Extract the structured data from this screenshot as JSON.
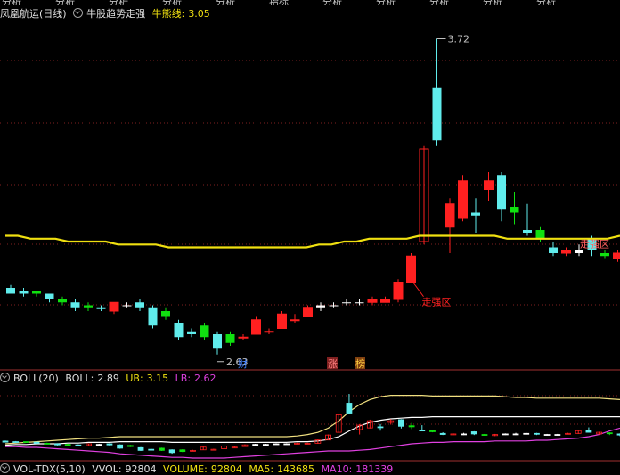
{
  "top_menu": [
    "分析",
    "分析",
    "分析",
    "分析",
    "分析",
    "指标",
    "分析",
    "分析",
    "分析",
    "分析",
    "分析"
  ],
  "header": {
    "stock_name": "凤凰航运(日线)",
    "indicator_name": "牛股趋势走强",
    "bull_line_label": "牛熊线:",
    "bull_line_value": "3.05"
  },
  "annotations": {
    "high_label": "3.72",
    "low_label": "2.63",
    "strong_zone": "走强区",
    "right_marker": "走强区",
    "event_cai": "财",
    "event_zhang": "涨",
    "event_bang": "榜"
  },
  "boll": {
    "name": "BOLL(20)",
    "boll_label": "BOLL:",
    "boll_value": "2.89",
    "ub_label": "UB:",
    "ub_value": "3.15",
    "lb_label": "LB:",
    "lb_value": "2.62"
  },
  "volume": {
    "name": "VOL-TDX(5,10)",
    "vvol_label": "VVOL:",
    "vvol_value": "92804",
    "volume_label": "VOLUME:",
    "volume_value": "92804",
    "ma5_label": "MA5:",
    "ma5_value": "143685",
    "ma10_label": "MA10:",
    "ma10_value": "181339"
  },
  "colors": {
    "up": "#ff2020",
    "down_cyan": "#60ecec",
    "green": "#10e010",
    "bull_line": "#f0e010",
    "boll_mid": "#ffffff",
    "boll_ub": "#f0e080",
    "boll_lb": "#e040e0",
    "grid": "#802020"
  },
  "chart_data": {
    "type": "candlestick",
    "y_range": [
      2.58,
      3.78
    ],
    "bull_line": [
      3.04,
      3.04,
      3.03,
      3.03,
      3.03,
      3.02,
      3.02,
      3.02,
      3.02,
      3.01,
      3.01,
      3.01,
      3.01,
      3.0,
      3.0,
      3.0,
      3.0,
      3.0,
      3.0,
      3.0,
      3.0,
      3.0,
      3.0,
      3.0,
      3.0,
      3.01,
      3.01,
      3.02,
      3.02,
      3.03,
      3.03,
      3.03,
      3.03,
      3.04,
      3.04,
      3.04,
      3.04,
      3.04,
      3.04,
      3.04,
      3.03,
      3.03,
      3.03,
      3.03,
      3.03,
      3.03,
      3.03,
      3.03,
      3.03,
      3.04
    ],
    "candles": [
      {
        "o": 2.86,
        "h": 2.87,
        "l": 2.84,
        "c": 2.84,
        "t": "c"
      },
      {
        "o": 2.85,
        "h": 2.86,
        "l": 2.83,
        "c": 2.84,
        "t": "c"
      },
      {
        "o": 2.85,
        "h": 2.85,
        "l": 2.83,
        "c": 2.84,
        "t": "g"
      },
      {
        "o": 2.84,
        "h": 2.84,
        "l": 2.81,
        "c": 2.82,
        "t": "c"
      },
      {
        "o": 2.82,
        "h": 2.83,
        "l": 2.8,
        "c": 2.81,
        "t": "g"
      },
      {
        "o": 2.81,
        "h": 2.82,
        "l": 2.78,
        "c": 2.79,
        "t": "c"
      },
      {
        "o": 2.8,
        "h": 2.81,
        "l": 2.78,
        "c": 2.79,
        "t": "g"
      },
      {
        "o": 2.79,
        "h": 2.8,
        "l": 2.78,
        "c": 2.79,
        "t": "c"
      },
      {
        "o": 2.78,
        "h": 2.81,
        "l": 2.77,
        "c": 2.81,
        "t": "r"
      },
      {
        "o": 2.8,
        "h": 2.81,
        "l": 2.79,
        "c": 2.8,
        "t": "w"
      },
      {
        "o": 2.81,
        "h": 2.82,
        "l": 2.78,
        "c": 2.79,
        "t": "c"
      },
      {
        "o": 2.79,
        "h": 2.8,
        "l": 2.72,
        "c": 2.73,
        "t": "c"
      },
      {
        "o": 2.78,
        "h": 2.79,
        "l": 2.75,
        "c": 2.76,
        "t": "g"
      },
      {
        "o": 2.74,
        "h": 2.75,
        "l": 2.68,
        "c": 2.69,
        "t": "c"
      },
      {
        "o": 2.7,
        "h": 2.72,
        "l": 2.69,
        "c": 2.71,
        "t": "c"
      },
      {
        "o": 2.73,
        "h": 2.74,
        "l": 2.68,
        "c": 2.69,
        "t": "g"
      },
      {
        "o": 2.7,
        "h": 2.71,
        "l": 2.63,
        "c": 2.65,
        "t": "c"
      },
      {
        "o": 2.67,
        "h": 2.71,
        "l": 2.66,
        "c": 2.7,
        "t": "g"
      },
      {
        "o": 2.69,
        "h": 2.7,
        "l": 2.68,
        "c": 2.69,
        "t": "r"
      },
      {
        "o": 2.7,
        "h": 2.76,
        "l": 2.7,
        "c": 2.75,
        "t": "r"
      },
      {
        "o": 2.71,
        "h": 2.72,
        "l": 2.7,
        "c": 2.71,
        "t": "r"
      },
      {
        "o": 2.72,
        "h": 2.78,
        "l": 2.72,
        "c": 2.77,
        "t": "r"
      },
      {
        "o": 2.75,
        "h": 2.77,
        "l": 2.74,
        "c": 2.75,
        "t": "r"
      },
      {
        "o": 2.76,
        "h": 2.8,
        "l": 2.76,
        "c": 2.79,
        "t": "r"
      },
      {
        "o": 2.8,
        "h": 2.81,
        "l": 2.78,
        "c": 2.79,
        "t": "w"
      },
      {
        "o": 2.8,
        "h": 2.81,
        "l": 2.79,
        "c": 2.8,
        "t": "w"
      },
      {
        "o": 2.81,
        "h": 2.82,
        "l": 2.8,
        "c": 2.81,
        "t": "w"
      },
      {
        "o": 2.81,
        "h": 2.82,
        "l": 2.8,
        "c": 2.81,
        "t": "w"
      },
      {
        "o": 2.82,
        "h": 2.83,
        "l": 2.8,
        "c": 2.81,
        "t": "r"
      },
      {
        "o": 2.81,
        "h": 2.83,
        "l": 2.81,
        "c": 2.82,
        "t": "r"
      },
      {
        "o": 2.82,
        "h": 2.89,
        "l": 2.81,
        "c": 2.88,
        "t": "r"
      },
      {
        "o": 2.88,
        "h": 2.98,
        "l": 2.88,
        "c": 2.97,
        "t": "r"
      },
      {
        "o": 3.02,
        "h": 3.35,
        "l": 3.01,
        "c": 3.34,
        "t": "ro"
      },
      {
        "o": 3.55,
        "h": 3.72,
        "l": 3.35,
        "c": 3.37,
        "t": "c"
      },
      {
        "o": 3.15,
        "h": 3.17,
        "l": 2.98,
        "c": 3.07,
        "t": "r"
      },
      {
        "o": 3.1,
        "h": 3.25,
        "l": 3.09,
        "c": 3.23,
        "t": "r"
      },
      {
        "o": 3.12,
        "h": 3.17,
        "l": 3.05,
        "c": 3.11,
        "t": "c"
      },
      {
        "o": 3.23,
        "h": 3.26,
        "l": 3.16,
        "c": 3.2,
        "t": "r"
      },
      {
        "o": 3.25,
        "h": 3.26,
        "l": 3.09,
        "c": 3.13,
        "t": "c"
      },
      {
        "o": 3.14,
        "h": 3.19,
        "l": 3.08,
        "c": 3.12,
        "t": "g"
      },
      {
        "o": 3.05,
        "h": 3.15,
        "l": 3.04,
        "c": 3.06,
        "t": "c"
      },
      {
        "o": 3.06,
        "h": 3.07,
        "l": 3.02,
        "c": 3.03,
        "t": "g"
      },
      {
        "o": 3.0,
        "h": 3.02,
        "l": 2.97,
        "c": 2.98,
        "t": "c"
      },
      {
        "o": 2.98,
        "h": 3.0,
        "l": 2.97,
        "c": 2.99,
        "t": "r"
      },
      {
        "o": 2.99,
        "h": 3.01,
        "l": 2.97,
        "c": 2.98,
        "t": "w"
      },
      {
        "o": 3.03,
        "h": 3.04,
        "l": 2.97,
        "c": 2.99,
        "t": "c"
      },
      {
        "o": 2.98,
        "h": 2.99,
        "l": 2.96,
        "c": 2.97,
        "t": "g"
      },
      {
        "o": 2.96,
        "h": 2.99,
        "l": 2.95,
        "c": 2.98,
        "t": "r"
      },
      {
        "o": 2.98,
        "h": 3.0,
        "l": 2.97,
        "c": 2.99,
        "t": "w"
      },
      {
        "o": 2.99,
        "h": 3.01,
        "l": 2.97,
        "c": 2.99,
        "t": "w"
      },
      {
        "o": 3.0,
        "h": 3.01,
        "l": 2.98,
        "c": 2.99,
        "t": "w"
      },
      {
        "o": 3.0,
        "h": 3.01,
        "l": 2.97,
        "c": 2.99,
        "t": "c"
      },
      {
        "o": 2.98,
        "h": 2.99,
        "l": 2.96,
        "c": 2.98,
        "t": "w"
      },
      {
        "o": 2.98,
        "h": 2.99,
        "l": 2.96,
        "c": 2.98,
        "t": "w"
      },
      {
        "o": 2.99,
        "h": 3.01,
        "l": 2.98,
        "c": 3.0,
        "t": "r"
      },
      {
        "o": 3.0,
        "h": 3.06,
        "l": 2.99,
        "c": 3.05,
        "t": "r"
      },
      {
        "o": 3.05,
        "h": 3.11,
        "l": 3.02,
        "c": 3.02,
        "t": "c"
      },
      {
        "o": 3.02,
        "h": 3.03,
        "l": 2.98,
        "c": 2.99,
        "t": "r"
      },
      {
        "o": 3.0,
        "h": 3.02,
        "l": 2.97,
        "c": 3.01,
        "t": "g"
      },
      {
        "o": 2.99,
        "h": 3.0,
        "l": 2.95,
        "c": 2.97,
        "t": "c"
      }
    ],
    "boll_series": {
      "mid": [
        0.18,
        0.19,
        0.19,
        0.2,
        0.2,
        0.2,
        0.21,
        0.21,
        0.22,
        0.22,
        0.22,
        0.23,
        0.23,
        0.23,
        0.23,
        0.23,
        0.22,
        0.22,
        0.22,
        0.22,
        0.22,
        0.22,
        0.22,
        0.22,
        0.22,
        0.22,
        0.22,
        0.22,
        0.23,
        0.23,
        0.24,
        0.26,
        0.3,
        0.38,
        0.45,
        0.5,
        0.53,
        0.55,
        0.56,
        0.57,
        0.57,
        0.58,
        0.58,
        0.58,
        0.58,
        0.58,
        0.58,
        0.58,
        0.58,
        0.58,
        0.58,
        0.58,
        0.58,
        0.58,
        0.58,
        0.58,
        0.58,
        0.58,
        0.58,
        0.58
      ],
      "ub": [
        0.2,
        0.21,
        0.22,
        0.23,
        0.24,
        0.25,
        0.26,
        0.27,
        0.28,
        0.28,
        0.29,
        0.3,
        0.3,
        0.3,
        0.3,
        0.3,
        0.3,
        0.3,
        0.3,
        0.3,
        0.3,
        0.3,
        0.3,
        0.3,
        0.3,
        0.3,
        0.3,
        0.3,
        0.31,
        0.33,
        0.36,
        0.42,
        0.52,
        0.65,
        0.75,
        0.82,
        0.86,
        0.88,
        0.88,
        0.88,
        0.88,
        0.87,
        0.87,
        0.87,
        0.87,
        0.87,
        0.87,
        0.87,
        0.86,
        0.85,
        0.85,
        0.84,
        0.84,
        0.84,
        0.84,
        0.84,
        0.84,
        0.84,
        0.83,
        0.82
      ],
      "lb": [
        0.16,
        0.16,
        0.15,
        0.15,
        0.14,
        0.13,
        0.12,
        0.11,
        0.1,
        0.09,
        0.08,
        0.06,
        0.05,
        0.04,
        0.03,
        0.02,
        0.01,
        0.01,
        0.0,
        0.0,
        0.0,
        0.0,
        0.01,
        0.02,
        0.03,
        0.04,
        0.05,
        0.06,
        0.07,
        0.08,
        0.09,
        0.1,
        0.1,
        0.1,
        0.11,
        0.12,
        0.14,
        0.16,
        0.18,
        0.2,
        0.21,
        0.22,
        0.22,
        0.23,
        0.23,
        0.23,
        0.23,
        0.24,
        0.24,
        0.24,
        0.24,
        0.25,
        0.25,
        0.26,
        0.27,
        0.28,
        0.3,
        0.33,
        0.38,
        0.42
      ]
    }
  }
}
